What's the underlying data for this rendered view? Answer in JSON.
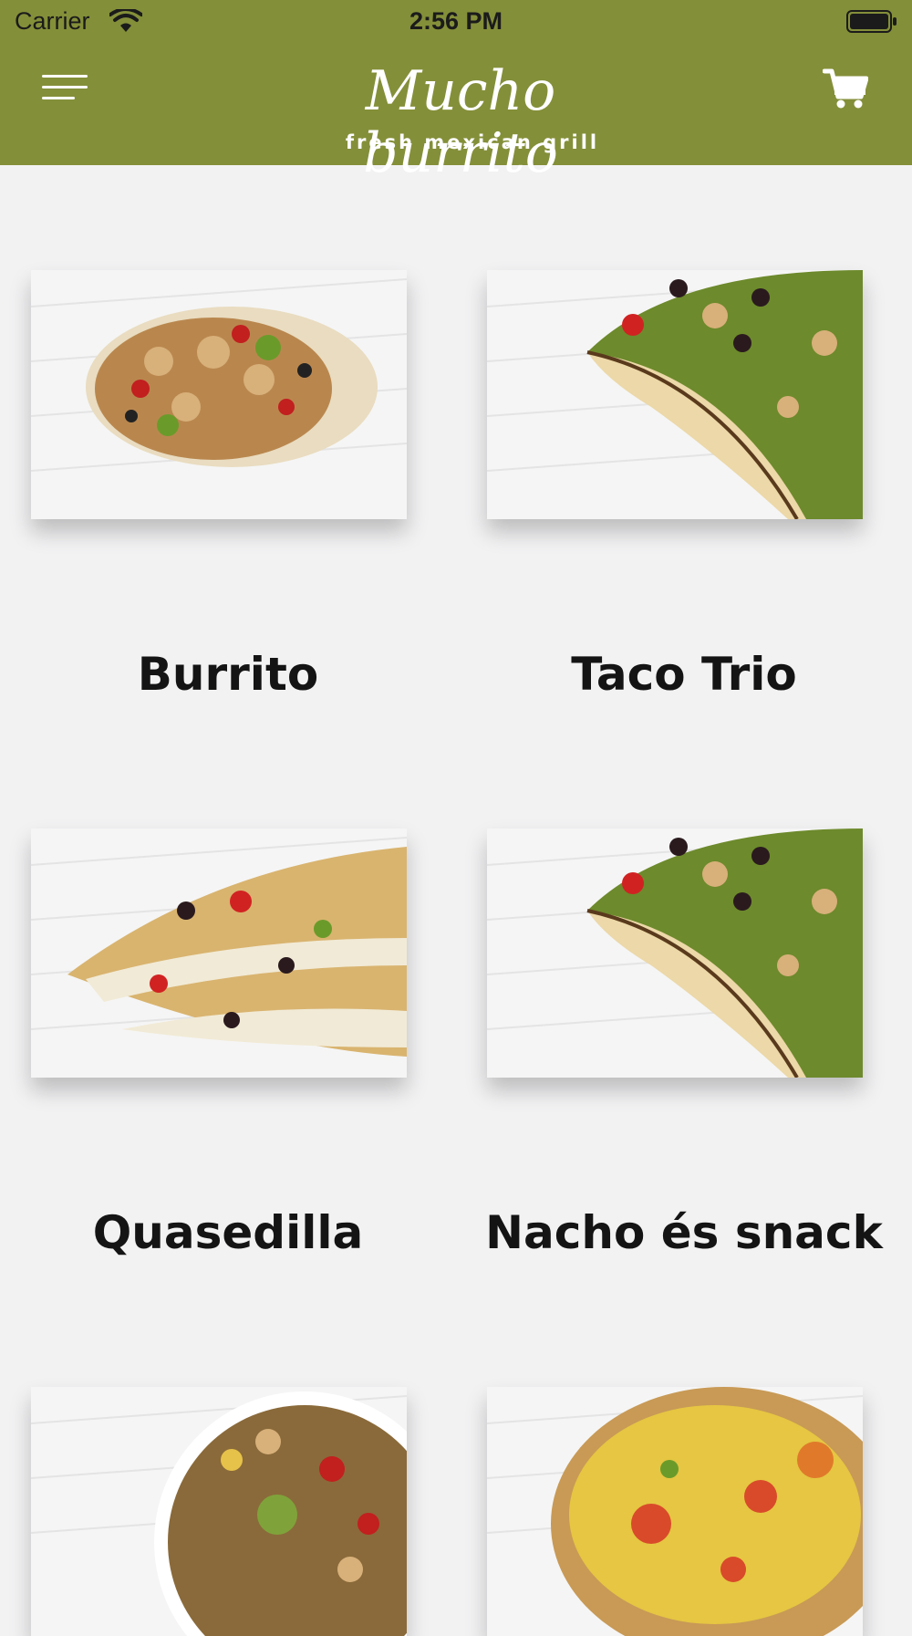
{
  "status_bar": {
    "carrier": "Carrier",
    "time": "2:56 PM"
  },
  "header": {
    "logo_main": "Mucho burrito",
    "logo_sub": "fresh mexican grill",
    "background_color": "#848f39",
    "menu_icon": "hamburger-menu-icon",
    "cart_icon": "shopping-cart-icon"
  },
  "menu_items": [
    {
      "label": "Burrito"
    },
    {
      "label": "Taco Trio"
    },
    {
      "label": "Quasedilla"
    },
    {
      "label": "Nacho és snack"
    },
    {
      "label": ""
    },
    {
      "label": ""
    }
  ]
}
